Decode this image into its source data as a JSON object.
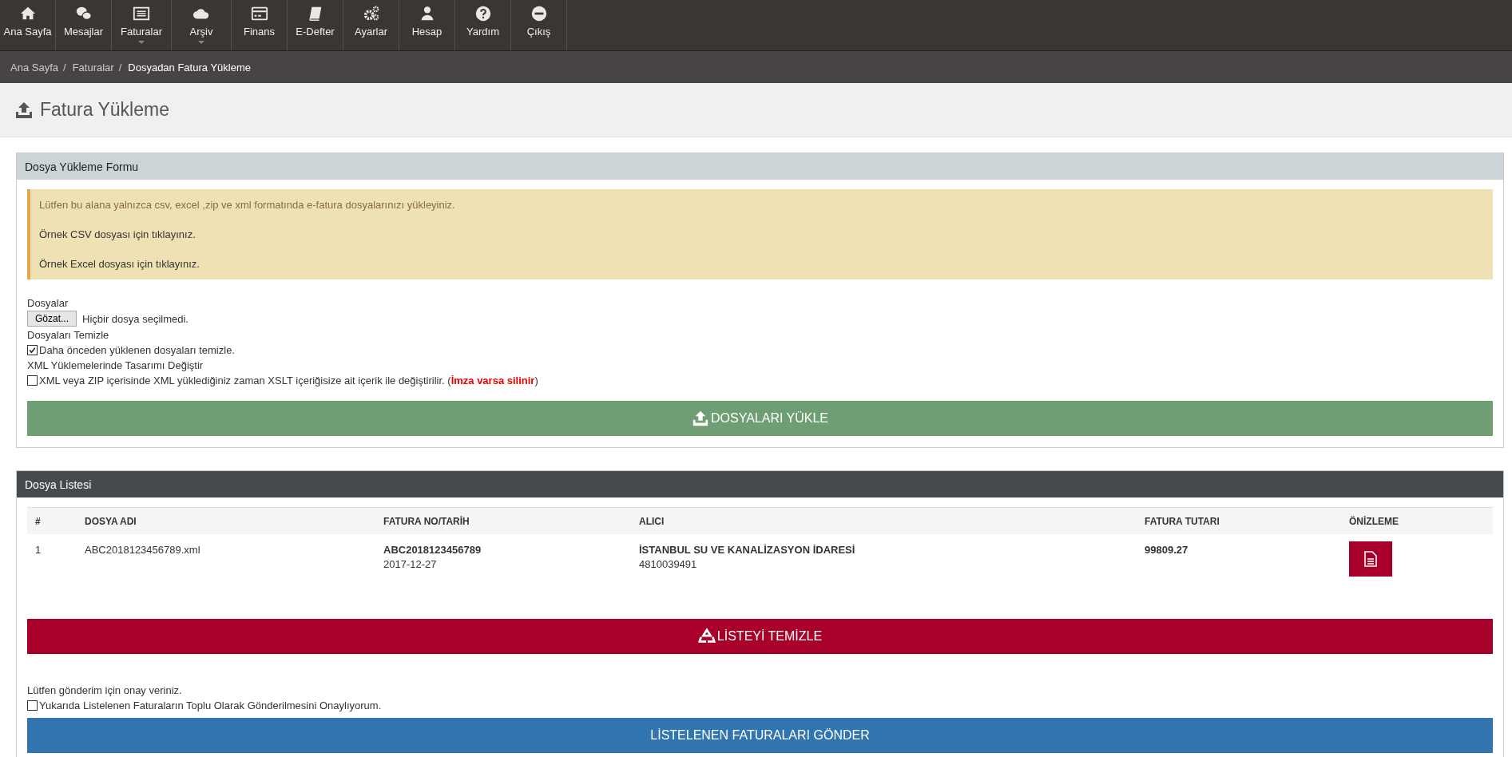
{
  "nav": [
    {
      "label": "Ana Sayfa",
      "has_menu": false
    },
    {
      "label": "Mesajlar",
      "has_menu": false
    },
    {
      "label": "Faturalar",
      "has_menu": true
    },
    {
      "label": "Arşiv",
      "has_menu": true
    },
    {
      "label": "Finans",
      "has_menu": false
    },
    {
      "label": "E-Defter",
      "has_menu": false
    },
    {
      "label": "Ayarlar",
      "has_menu": false
    },
    {
      "label": "Hesap",
      "has_menu": false
    },
    {
      "label": "Yardım",
      "has_menu": false
    },
    {
      "label": "Çıkış",
      "has_menu": false
    }
  ],
  "breadcrumb": [
    {
      "label": "Ana Sayfa",
      "current": false,
      "separator": "/"
    },
    {
      "label": "Faturalar",
      "current": false,
      "separator": "/"
    },
    {
      "label": "Dosyadan Fatura Yükleme",
      "current": true
    }
  ],
  "page_title": "Fatura Yükleme",
  "upload_panel": {
    "title": "Dosya Yükleme Formu",
    "alert": [
      "Lütfen bu alana yalnızca csv, excel ,zip ve xml formatında e-fatura dosyalarınızı yükleyiniz.",
      "Örnek CSV dosyası için tıklayınız.",
      "Örnek Excel dosyası için tıklayınız."
    ],
    "files_label": "Dosyalar",
    "browse_button": "Gözat...",
    "no_file": "Hiçbir dosya seçilmedi.",
    "options": [
      {
        "heading": "Dosyaları Temizle",
        "label": "Daha önceden yüklenen dosyaları temizle.",
        "checked": true
      },
      {
        "heading": "XML Yüklemelerinde Tasarımı Değiştir",
        "label": "XML veya ZIP içerisinde XML yüklediğiniz zaman XSLT içeriğisize ait içerik ile değiştirilir. (**İmza varsa silinir**)",
        "checked": false
      }
    ],
    "upload_button": "DOSYALARI YÜKLE"
  },
  "list_panel": {
    "title": "Dosya Listesi",
    "table": {
      "columns": [
        "#",
        "DOSYA ADI",
        "FATURA NO/TARİH",
        "ALICI",
        "FATURA TUTARI",
        "ÖNİZLEME"
      ],
      "rows": [
        {
          "index": "1",
          "file": "ABC2018123456789.xml",
          "invoice_no": "ABC2018123456789",
          "date": "2017-12-27",
          "recipient": "İSTANBUL SU VE KANALİZASYON İDARESİ",
          "tax_no": "4810039491",
          "amount": "99809.27"
        }
      ]
    },
    "clear_button": "LİSTEYİ TEMİZLE",
    "confirm_text": "Lütfen gönderim için onay veriniz.",
    "confirm": {
      "label": "Yukarıda Listelenen Faturaların Toplu Olarak Gönderilmesini Onaylıyorum.",
      "checked": false
    },
    "send_button": "LİSTELENEN FATURALARI GÖNDER"
  }
}
